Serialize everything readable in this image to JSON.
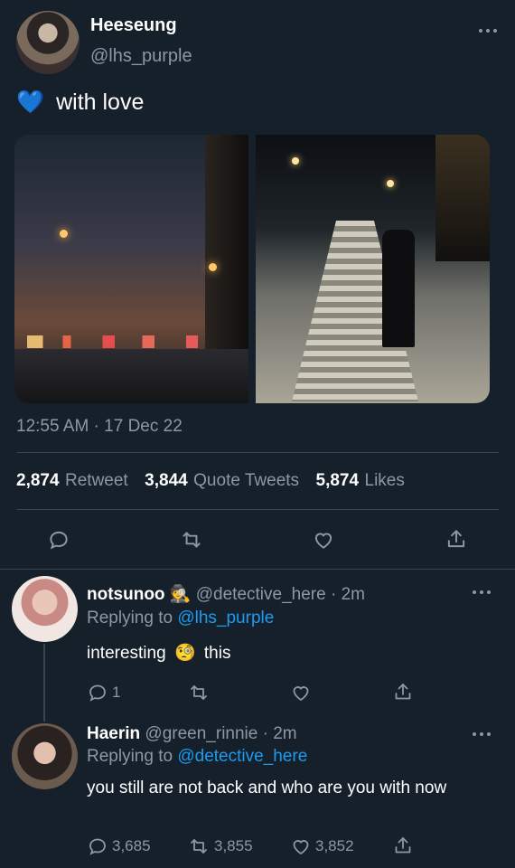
{
  "main_tweet": {
    "author_name": "Heeseung",
    "author_handle": "@lhs_purple",
    "emoji": "💙",
    "text": "with love",
    "timestamp": "12:55 AM · 17 Dec 22",
    "stats": {
      "retweet_count": "2,874",
      "retweet_label": "Retweet",
      "quote_count": "3,844",
      "quote_label": "Quote Tweets",
      "like_count": "5,874",
      "like_label": "Likes"
    },
    "actions": [
      "reply-icon",
      "retweet-icon",
      "like-icon",
      "share-icon"
    ]
  },
  "replies": [
    {
      "name": "notsunoo",
      "badge_emoji": "🕵",
      "handle": "@detective_here",
      "time": "· 2m",
      "replying_prefix": "Replying to",
      "replying_to": "@lhs_purple",
      "text_before": "interesting",
      "text_emoji": "🧐",
      "text_after": "this",
      "reply_count": "1",
      "retweet_count": "",
      "like_count": ""
    },
    {
      "name": "Haerin",
      "handle": "@green_rinnie",
      "time": "· 2m",
      "replying_prefix": "Replying to",
      "replying_to": "@detective_here",
      "text": "you still are not back and who are you with now",
      "reply_count": "3,685",
      "retweet_count": "3,855",
      "like_count": "3,852"
    }
  ],
  "colors": {
    "background": "#15202b",
    "muted": "#8b98a5",
    "link": "#1d9bf0",
    "divider": "#38444d"
  }
}
